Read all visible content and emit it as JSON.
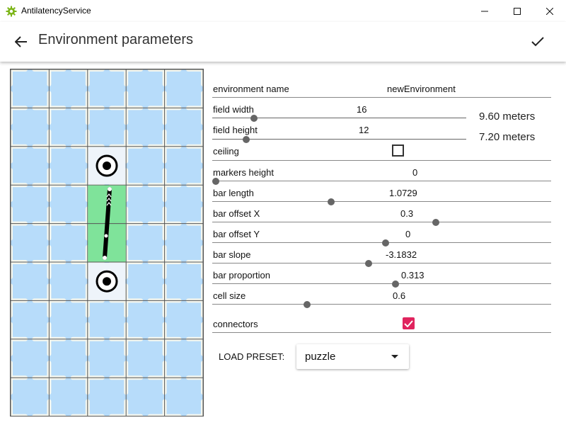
{
  "window": {
    "app_title": "AntilatencyService"
  },
  "header": {
    "title": "Environment parameters"
  },
  "params": {
    "environment_name": {
      "label": "environment name",
      "value": "newEnvironment"
    },
    "field_width": {
      "label": "field width",
      "value": "16",
      "slider": 0.15,
      "meters": "9.60 meters"
    },
    "field_height": {
      "label": "field height",
      "value": "12",
      "slider": 0.12,
      "meters": "7.20 meters"
    },
    "ceiling": {
      "label": "ceiling",
      "checked": false
    },
    "markers_height": {
      "label": "markers height",
      "value": "0",
      "slider": 0.0
    },
    "bar_length": {
      "label": "bar length",
      "value": "1.0729",
      "slider": 0.34
    },
    "bar_offset_x": {
      "label": "bar offset X",
      "value": "0.3",
      "slider": 0.65
    },
    "bar_offset_y": {
      "label": "bar offset Y",
      "value": "0",
      "slider": 0.5
    },
    "bar_slope": {
      "label": "bar slope",
      "value": "-3.1832",
      "slider": 0.45
    },
    "bar_proportion": {
      "label": "bar proportion",
      "value": "0.313",
      "slider": 0.53
    },
    "cell_size": {
      "label": "cell size",
      "value": "0.6",
      "slider": 0.27
    },
    "connectors": {
      "label": "connectors",
      "checked": true
    }
  },
  "preset": {
    "label": "LOAD PRESET:",
    "value": "puzzle"
  },
  "colors": {
    "accent": "#e0245e",
    "grid_bg": "#b7dcfa",
    "cell_green": "#7fe39a",
    "app_icon": "#7cb518"
  }
}
